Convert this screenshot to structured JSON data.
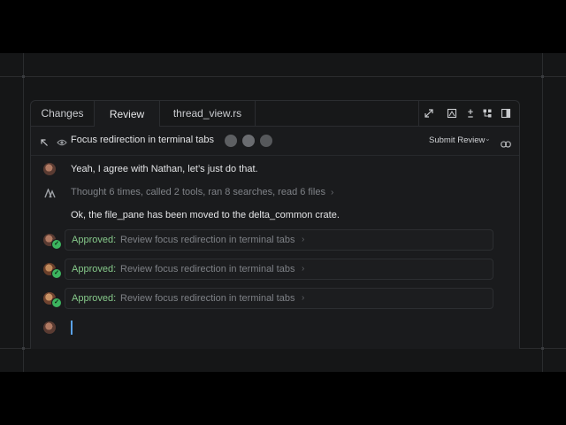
{
  "tabs": [
    {
      "label": "Changes"
    },
    {
      "label": "Review"
    },
    {
      "label": "thread_view.rs"
    }
  ],
  "header": {
    "title": "Focus redirection in terminal tabs",
    "submit_label": "Submit Review"
  },
  "messages": {
    "user_message": "Yeah, I agree with Nathan, let’s just do that.",
    "thought_summary": "Thought 6 times, called 2 tools, ran 8 searches, read 6 files",
    "agent_reply": "Ok, the file_pane has been moved to the delta_common crate."
  },
  "approvals": [
    {
      "status": "Approved:",
      "text": "Review focus redirection in terminal tabs"
    },
    {
      "status": "Approved:",
      "text": "Review focus redirection in terminal tabs"
    },
    {
      "status": "Approved:",
      "text": "Review focus redirection in terminal tabs"
    }
  ],
  "colors": {
    "approved": "#86c98a",
    "check_badge": "#3cb55f",
    "cursor": "#5aa2e8",
    "panel_bg": "#1a1b1d"
  },
  "icons": {
    "tab_toolbar": [
      "expand-icon",
      "image-icon",
      "plus-minus-icon",
      "branch-icon",
      "sidebar-icon"
    ],
    "header": [
      "arrow-up-left-icon",
      "eye-icon",
      "chevron-down-icon",
      "link-icon"
    ]
  }
}
